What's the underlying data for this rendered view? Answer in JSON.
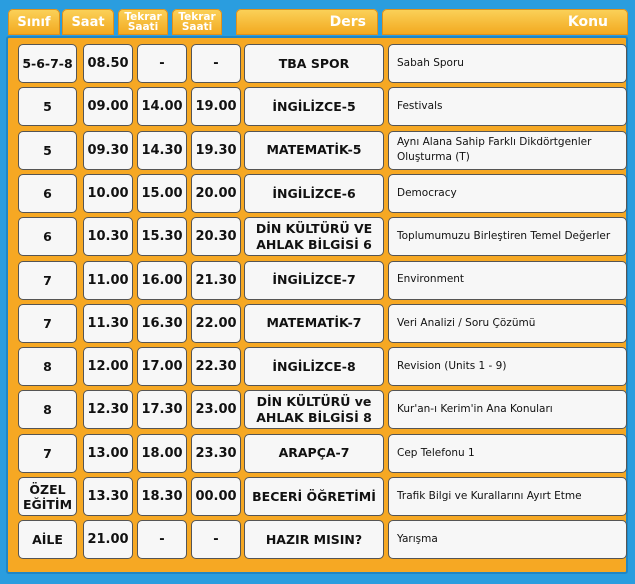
{
  "header": {
    "sinif": "Sınıf",
    "saat": "Saat",
    "tekrar1": "Tekrar Saati",
    "tekrar2": "Tekrar Saati",
    "ders": "Ders",
    "konu": "Konu"
  },
  "rows": [
    {
      "sinif": "5-6-7-8",
      "saat": "08.50",
      "tekrar1": "-",
      "tekrar2": "-",
      "ders": "TBA SPOR",
      "konu": "Sabah Sporu"
    },
    {
      "sinif": "5",
      "saat": "09.00",
      "tekrar1": "14.00",
      "tekrar2": "19.00",
      "ders": "İNGİLİZCE-5",
      "konu": "Festivals"
    },
    {
      "sinif": "5",
      "saat": "09.30",
      "tekrar1": "14.30",
      "tekrar2": "19.30",
      "ders": "MATEMATİK-5",
      "konu": "Aynı Alana Sahip Farklı Dikdörtgenler Oluşturma (T)"
    },
    {
      "sinif": "6",
      "saat": "10.00",
      "tekrar1": "15.00",
      "tekrar2": "20.00",
      "ders": "İNGİLİZCE-6",
      "konu": "Democracy"
    },
    {
      "sinif": "6",
      "saat": "10.30",
      "tekrar1": "15.30",
      "tekrar2": "20.30",
      "ders": "DİN KÜLTÜRÜ VE AHLAK BİLGİSİ 6",
      "konu": "Toplumumuzu Birleştiren Temel Değerler"
    },
    {
      "sinif": "7",
      "saat": "11.00",
      "tekrar1": "16.00",
      "tekrar2": "21.30",
      "ders": "İNGİLİZCE-7",
      "konu": "Environment"
    },
    {
      "sinif": "7",
      "saat": "11.30",
      "tekrar1": "16.30",
      "tekrar2": "22.00",
      "ders": "MATEMATİK-7",
      "konu": "Veri Analizi / Soru Çözümü"
    },
    {
      "sinif": "8",
      "saat": "12.00",
      "tekrar1": "17.00",
      "tekrar2": "22.30",
      "ders": "İNGİLİZCE-8",
      "konu": "Revision (Units 1 - 9)"
    },
    {
      "sinif": "8",
      "saat": "12.30",
      "tekrar1": "17.30",
      "tekrar2": "23.00",
      "ders": "DİN KÜLTÜRÜ ve AHLAK BİLGİSİ 8",
      "konu": "Kur'an-ı Kerim'in Ana Konuları"
    },
    {
      "sinif": "7",
      "saat": "13.00",
      "tekrar1": "18.00",
      "tekrar2": "23.30",
      "ders": "ARAPÇA-7",
      "konu": "Cep Telefonu 1"
    },
    {
      "sinif": "ÖZEL EĞİTİM",
      "saat": "13.30",
      "tekrar1": "18.30",
      "tekrar2": "00.00",
      "ders": "BECERİ ÖĞRETİMİ",
      "konu": "Trafik Bilgi ve Kurallarını Ayırt Etme"
    },
    {
      "sinif": "AİLE",
      "saat": "21.00",
      "tekrar1": "-",
      "tekrar2": "-",
      "ders": "HAZIR MISIN?",
      "konu": "Yarışma"
    }
  ]
}
